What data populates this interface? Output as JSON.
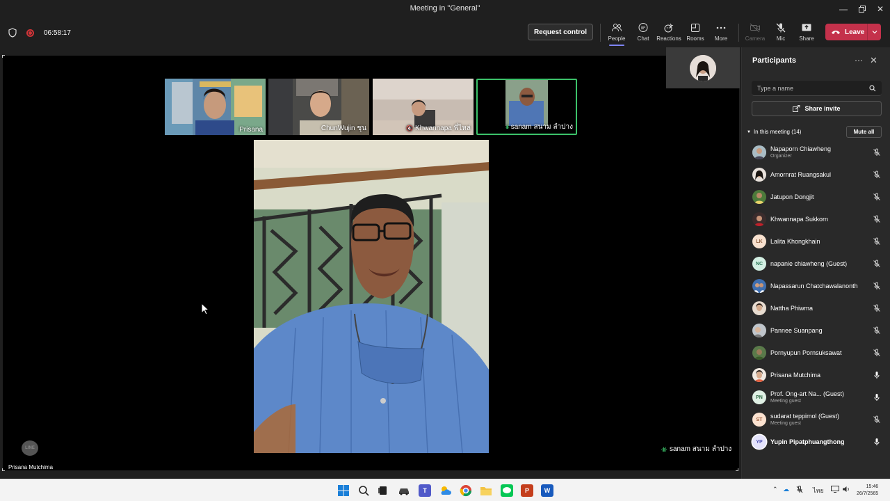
{
  "window": {
    "title": "Meeting in \"General\""
  },
  "toolbar": {
    "timer": "06:58:17",
    "request_control": "Request control",
    "items": {
      "people": "People",
      "chat": "Chat",
      "reactions": "Reactions",
      "rooms": "Rooms",
      "more": "More",
      "camera": "Camera",
      "mic": "Mic",
      "share": "Share"
    },
    "leave": "Leave",
    "accent": "#c4314b"
  },
  "stage": {
    "thumbnails": [
      {
        "name": "Prisana"
      },
      {
        "name": "ChunWujin ชุน"
      },
      {
        "name": "Khwannapa พี่ไหล่"
      },
      {
        "name": "sanam สนาม ลำปาง"
      }
    ],
    "active_speaker": "sanam สนาม ลำปาง",
    "bottom_name": "Prisana Mutchima",
    "line_logo": "LINE"
  },
  "panel": {
    "title": "Participants",
    "search_placeholder": "Type a name",
    "share_invite": "Share invite",
    "section_label": "In this meeting (14)",
    "mute_all": "Mute all",
    "participants": [
      {
        "name": "Napaporn Chiawheng",
        "role": "Organizer",
        "initials": "",
        "mic": "muted"
      },
      {
        "name": "Amornrat Ruangsakul",
        "role": "",
        "initials": "",
        "mic": "muted"
      },
      {
        "name": "Jatupon Dongjit",
        "role": "",
        "initials": "",
        "mic": "muted"
      },
      {
        "name": "Khwannapa Sukkorn",
        "role": "",
        "initials": "",
        "mic": "muted"
      },
      {
        "name": "Lalita Khongkhain",
        "role": "",
        "initials": "LK",
        "mic": "muted"
      },
      {
        "name": "napanie chiawheng (Guest)",
        "role": "",
        "initials": "NC",
        "mic": "muted"
      },
      {
        "name": "Napassarun Chatchawalanonth",
        "role": "",
        "initials": "",
        "mic": "muted"
      },
      {
        "name": "Nattha Phiwma",
        "role": "",
        "initials": "",
        "mic": "muted"
      },
      {
        "name": "Pannee Suanpang",
        "role": "",
        "initials": "",
        "mic": "muted"
      },
      {
        "name": "Pornyupun Pornsuksawat",
        "role": "",
        "initials": "",
        "mic": "muted"
      },
      {
        "name": "Prisana Mutchima",
        "role": "",
        "initials": "",
        "mic": "on"
      },
      {
        "name": "Prof. Ong-art Na... (Guest)",
        "role": "Meeting guest",
        "initials": "PN",
        "mic": "on"
      },
      {
        "name": "sudarat teppimol (Guest)",
        "role": "Meeting guest",
        "initials": "ST",
        "mic": "muted"
      },
      {
        "name": "Yupin Pipatphuangthong",
        "role": "",
        "initials": "YP",
        "mic": "on"
      }
    ]
  },
  "taskbar": {
    "lang": "ไทย",
    "time": "15:46",
    "date": "26/7/2565"
  }
}
